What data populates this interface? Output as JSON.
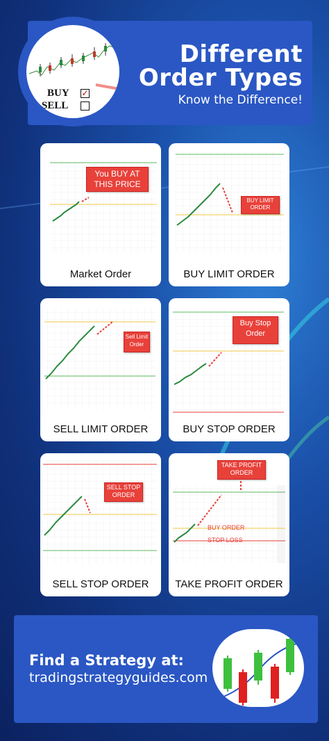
{
  "header": {
    "title_line1": "Different",
    "title_line2": "Order Types",
    "subtitle": "Know the Difference!",
    "logo_buy": "BUY",
    "logo_sell": "SELL"
  },
  "cards": [
    {
      "label": "Market Order",
      "callout": "You BUY AT THIS PRICE"
    },
    {
      "label": "BUY LIMIT ORDER",
      "callout": "BUY LIMIT ORDER"
    },
    {
      "label": "SELL LIMIT ORDER",
      "callout": "Sell Limit Order"
    },
    {
      "label": "BUY STOP ORDER",
      "callout": "Buy Stop Order"
    },
    {
      "label": "SELL STOP ORDER",
      "callout": "SELL STOP ORDER"
    },
    {
      "label": "TAKE PROFIT ORDER",
      "callout": "TAKE PROFIT ORDER",
      "buy_order": "BUY ORDER",
      "stop_loss": "STOP LOSS"
    }
  ],
  "footer": {
    "title": "Find a Strategy at:",
    "url": "tradingstrategyguides.com"
  },
  "colors": {
    "brand_blue": "#2a57c4",
    "callout_red": "#e8413a",
    "candle_green": "#2b8a3e",
    "line_yellow": "#f2c744",
    "line_green": "#5cb85c"
  }
}
